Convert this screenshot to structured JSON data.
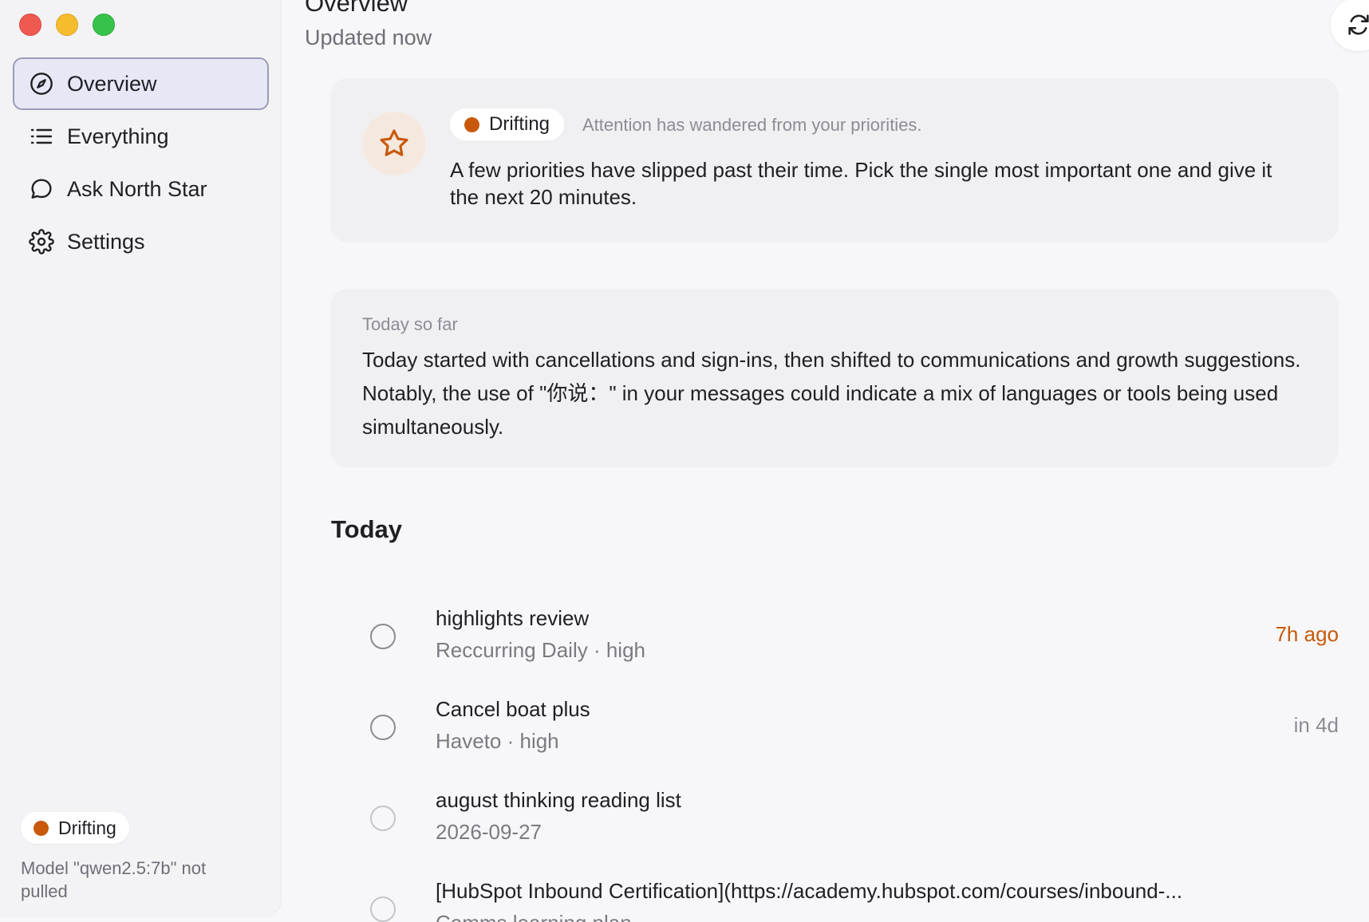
{
  "window": {
    "controls": [
      "close",
      "minimize",
      "zoom"
    ]
  },
  "sidebar": {
    "items": [
      {
        "label": "Overview",
        "icon": "compass-icon",
        "active": true
      },
      {
        "label": "Everything",
        "icon": "list-icon",
        "active": false
      },
      {
        "label": "Ask North Star",
        "icon": "chat-bubble-icon",
        "active": false
      },
      {
        "label": "Settings",
        "icon": "gear-icon",
        "active": false
      }
    ],
    "status": {
      "label": "Drifting",
      "color": "#c8590a"
    },
    "note": "Model \"qwen2.5:7b\" not pulled"
  },
  "header": {
    "title": "Overview",
    "subtitle": "Updated now",
    "refresh_icon": "refresh-icon"
  },
  "drift_card": {
    "icon": "star-icon",
    "status_label": "Drifting",
    "status_note": "Attention has wandered from your priorities.",
    "message": "A few priorities have slipped past their time. Pick the single most important one and give it the next 20 minutes."
  },
  "today_card": {
    "label": "Today so far",
    "text": "Today started with cancellations and sign-ins, then shifted to communications and growth suggestions. Notably, the use of \"你说：\" in your messages could indicate a mix of languages or tools being used simultaneously."
  },
  "today_section": {
    "title": "Today",
    "tasks": [
      {
        "title": "highlights review",
        "meta": "Reccurring Daily · high",
        "when": "7h ago",
        "overdue": true
      },
      {
        "title": "Cancel boat plus",
        "meta": "Haveto · high",
        "when": "in 4d",
        "overdue": false
      },
      {
        "title": "august thinking reading list",
        "meta": "2026-09-27",
        "when": "",
        "overdue": false
      },
      {
        "title": "[HubSpot Inbound Certification](https://academy.hubspot.com/courses/inbound-...",
        "meta": "Comms learning plan",
        "when": "",
        "overdue": false
      }
    ]
  },
  "colors": {
    "accent": "#c8590a",
    "active_nav_bg": "#e7e8f6"
  }
}
